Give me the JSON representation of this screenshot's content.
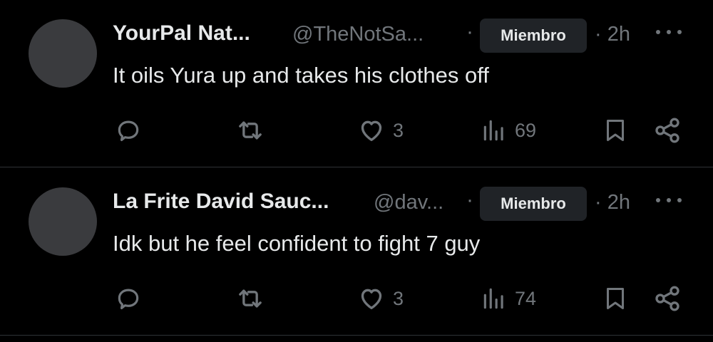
{
  "posts": [
    {
      "name": "YourPal Nat...",
      "handle": "@TheNotSa...",
      "separator": "·",
      "badge": "Miembro",
      "time": "· 2h",
      "text": "It oils Yura up and takes his clothes off",
      "likes": "3",
      "views": "69"
    },
    {
      "name": "La Frite David Sauc...",
      "handle": "@dav...",
      "separator": "·",
      "badge": "Miembro",
      "time": "· 2h",
      "text": "Idk but he feel confident to fight 7 guy",
      "likes": "3",
      "views": "74"
    }
  ],
  "icons": {
    "reply": "reply-icon",
    "repost": "repost-icon",
    "like": "heart-icon",
    "views": "views-icon",
    "bookmark": "bookmark-icon",
    "share": "share-icon",
    "more": "more-icon"
  },
  "colors": {
    "background": "#000000",
    "text": "#e7e9ea",
    "muted": "#71767b",
    "badge_bg": "#202327",
    "divider": "#2f3336",
    "avatar": "#3a3b3e"
  }
}
